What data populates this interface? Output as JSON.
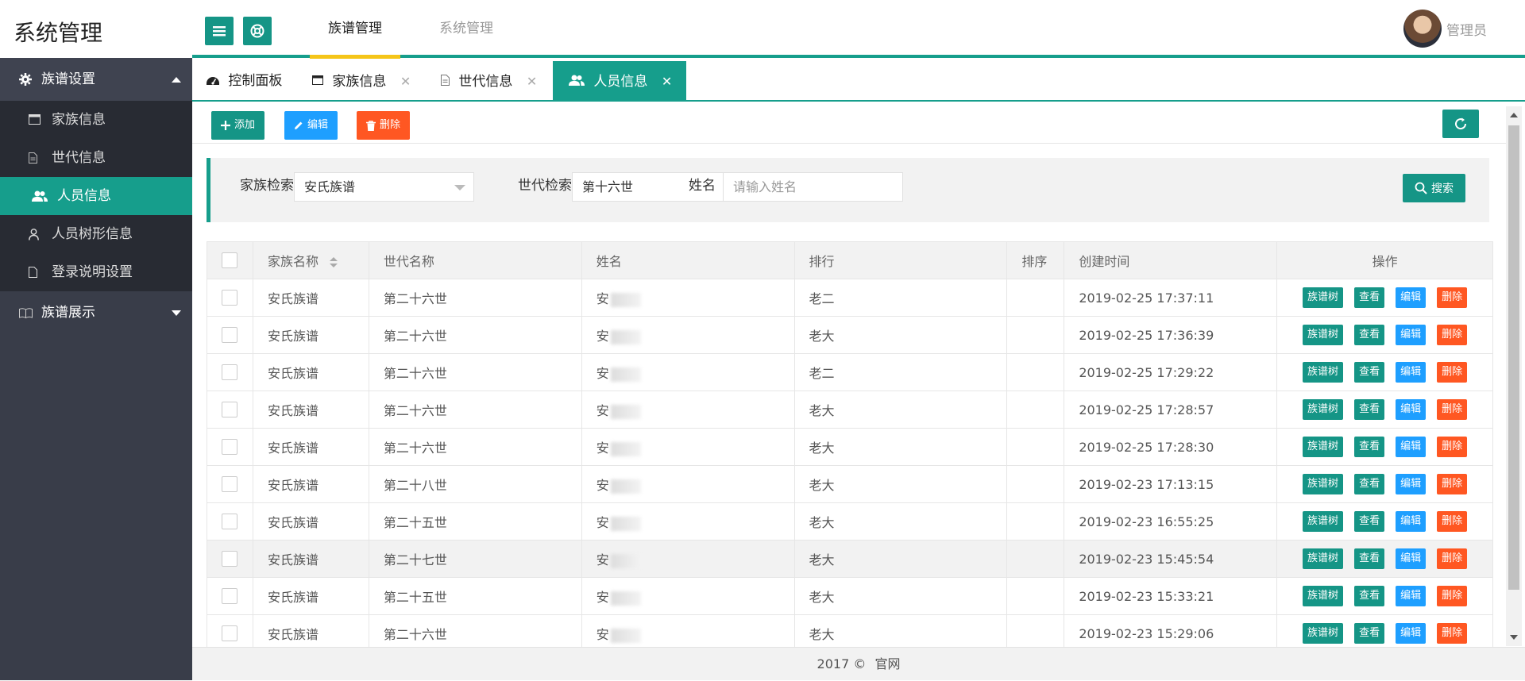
{
  "app": {
    "title": "系统管理"
  },
  "topnav": {
    "items": [
      {
        "label": "族谱管理"
      },
      {
        "label": "系统管理"
      }
    ],
    "user": "管理员"
  },
  "sidebar": {
    "group1": {
      "label": "族谱设置",
      "items": [
        {
          "label": "家族信息"
        },
        {
          "label": "世代信息"
        },
        {
          "label": "人员信息"
        },
        {
          "label": "人员树形信息"
        },
        {
          "label": "登录说明设置"
        }
      ]
    },
    "group2": {
      "label": "族谱展示"
    }
  },
  "tabs": [
    {
      "label": "控制面板"
    },
    {
      "label": "家族信息"
    },
    {
      "label": "世代信息"
    },
    {
      "label": "人员信息"
    }
  ],
  "toolbar": {
    "add": "添加",
    "edit": "编辑",
    "delete": "删除"
  },
  "search": {
    "family_label": "家族检索",
    "family_value": "安氏族谱",
    "gen_label": "世代检索",
    "gen_value": "第十六世",
    "name_label": "姓名",
    "name_placeholder": "请输入姓名",
    "button": "搜索"
  },
  "table": {
    "headers": {
      "family": "家族名称",
      "generation": "世代名称",
      "name": "姓名",
      "rank": "排行",
      "order": "排序",
      "created": "创建时间",
      "ops": "操作"
    },
    "ops": {
      "tree": "族谱树",
      "view": "查看",
      "edit": "编辑",
      "delete": "删除"
    },
    "rows": [
      {
        "family": "安氏族谱",
        "generation": "第二十六世",
        "name": "安",
        "rank": "老二",
        "order": "",
        "created": "2019-02-25 17:37:11"
      },
      {
        "family": "安氏族谱",
        "generation": "第二十六世",
        "name": "安",
        "rank": "老大",
        "order": "",
        "created": "2019-02-25 17:36:39"
      },
      {
        "family": "安氏族谱",
        "generation": "第二十六世",
        "name": "安",
        "rank": "老二",
        "order": "",
        "created": "2019-02-25 17:29:22"
      },
      {
        "family": "安氏族谱",
        "generation": "第二十六世",
        "name": "安",
        "rank": "老大",
        "order": "",
        "created": "2019-02-25 17:28:57"
      },
      {
        "family": "安氏族谱",
        "generation": "第二十六世",
        "name": "安",
        "rank": "老大",
        "order": "",
        "created": "2019-02-25 17:28:30"
      },
      {
        "family": "安氏族谱",
        "generation": "第二十八世",
        "name": "安",
        "rank": "老大",
        "order": "",
        "created": "2019-02-23 17:13:15"
      },
      {
        "family": "安氏族谱",
        "generation": "第二十五世",
        "name": "安",
        "rank": "老大",
        "order": "",
        "created": "2019-02-23 16:55:25"
      },
      {
        "family": "安氏族谱",
        "generation": "第二十七世",
        "name": "安",
        "rank": "老大",
        "order": "",
        "created": "2019-02-23 15:45:54"
      },
      {
        "family": "安氏族谱",
        "generation": "第二十五世",
        "name": "安",
        "rank": "老大",
        "order": "",
        "created": "2019-02-23 15:33:21"
      },
      {
        "family": "安氏族谱",
        "generation": "第二十六世",
        "name": "安",
        "rank": "老大",
        "order": "",
        "created": "2019-02-23 15:29:06"
      }
    ]
  },
  "footer": {
    "year": "2017 ©",
    "link": "官网"
  },
  "colors": {
    "primary": "#169e8c",
    "blue": "#1e9fff",
    "orange": "#ff5722",
    "sidebar": "#393d49"
  }
}
